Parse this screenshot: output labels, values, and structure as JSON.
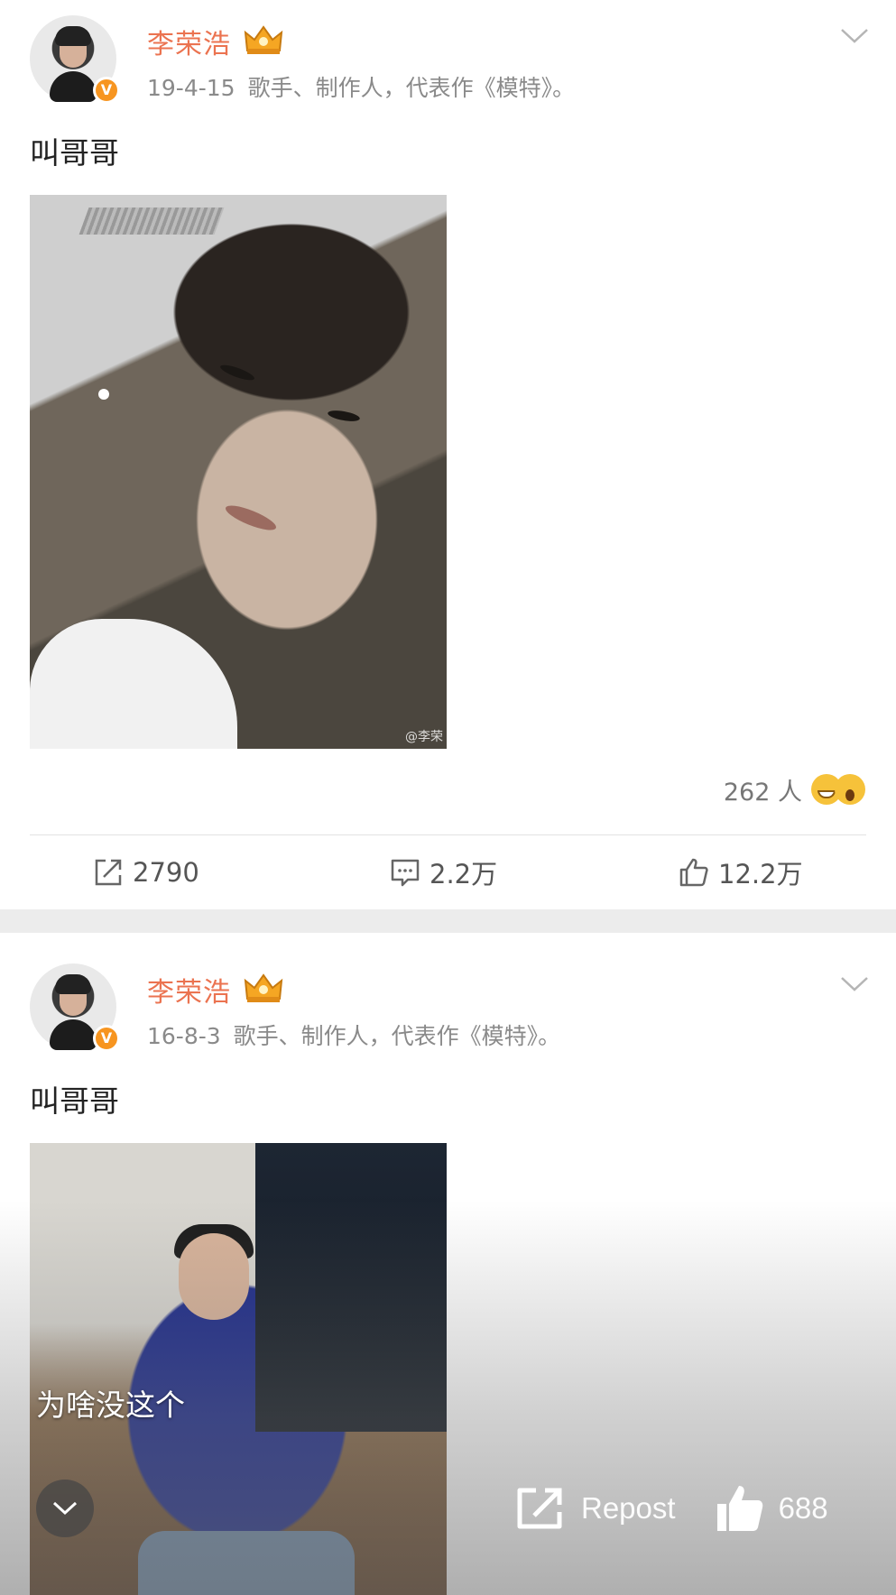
{
  "posts": [
    {
      "username": "李荣浩",
      "date": "19-4-15",
      "bio": "歌手、制作人，代表作《模特》。",
      "text": "叫哥哥",
      "watermark": "@李荣",
      "reactions": {
        "count_label": "262 人",
        "emojis": [
          "grin-emoji-icon",
          "shocked-emoji-icon"
        ]
      },
      "actions": {
        "repost": "2790",
        "comment": "2.2万",
        "like": "12.2万"
      }
    },
    {
      "username": "李荣浩",
      "date": "16-8-3",
      "bio": "歌手、制作人，代表作《模特》。",
      "text": "叫哥哥"
    }
  ],
  "overlay": {
    "caption": "为啥没这个",
    "repost_label": "Repost",
    "like_count": "688"
  },
  "colors": {
    "username": "#eb7350",
    "verified_badge": "#f79520",
    "separator": "#ececec"
  },
  "icons": {
    "verified": "V",
    "crown": "crown-icon",
    "menu": "chevron-down-icon",
    "repost": "repost-icon",
    "comment": "comment-icon",
    "like": "thumbs-up-icon"
  }
}
